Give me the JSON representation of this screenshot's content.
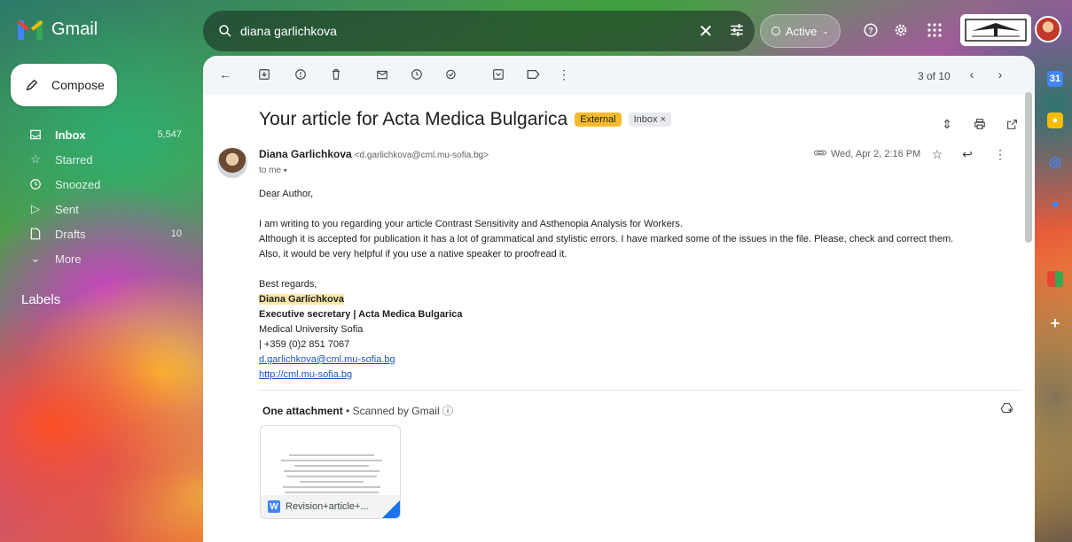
{
  "app": {
    "name": "Gmail"
  },
  "search": {
    "query": "diana garlichkova"
  },
  "status": {
    "label": "Active"
  },
  "compose": {
    "label": "Compose"
  },
  "nav": {
    "items": [
      {
        "label": "Inbox",
        "count": "5,547",
        "icon": "inbox-icon"
      },
      {
        "label": "Starred",
        "count": "",
        "icon": "star-icon"
      },
      {
        "label": "Snoozed",
        "count": "",
        "icon": "clock-icon"
      },
      {
        "label": "Sent",
        "count": "",
        "icon": "send-icon"
      },
      {
        "label": "Drafts",
        "count": "10",
        "icon": "draft-icon"
      },
      {
        "label": "More",
        "count": "",
        "icon": "chevron-down-icon"
      }
    ],
    "labels_heading": "Labels"
  },
  "toolbar": {
    "pager": "3 of 10"
  },
  "message": {
    "subject": "Your article for Acta Medica Bulgarica",
    "badge_external": "External",
    "badge_inbox": "Inbox ×",
    "sender_name": "Diana Garlichkova",
    "sender_email": "<d.garlichkova@cml.mu-sofia.bg>",
    "to": "to me",
    "date": "Wed, Apr 2, 2:16 PM",
    "greeting": "Dear Author,",
    "para1": "I am writing to you regarding your article Contrast Sensitivity and Asthenopia Analysis for Workers.",
    "para2": "Although it is accepted for publication it has a lot of grammatical and stylistic errors. I have marked some of the issues in the file. Please, check and correct them.",
    "para3": "Also, it would be very helpful if you use a native speaker to proofread it.",
    "closing": "Best regards,",
    "sig_name": "Diana Garlichkova",
    "sig_title": "Executive secretary | Acta Medica Bulgarica",
    "sig_org": "Medical University Sofia",
    "sig_phone": "| +359 (0)2 851 7067",
    "sig_email": "d.garlichkova@cml.mu-sofia.bg",
    "sig_url": "http://cml.mu-sofia.bg"
  },
  "attachments": {
    "heading": "One attachment",
    "scanned": "• Scanned by Gmail ⓘ",
    "file_name": "Revision+article+..."
  },
  "colors": {
    "external_badge": "#f6bb2c",
    "highlight": "#fce8a6",
    "link": "#1a55c5"
  }
}
